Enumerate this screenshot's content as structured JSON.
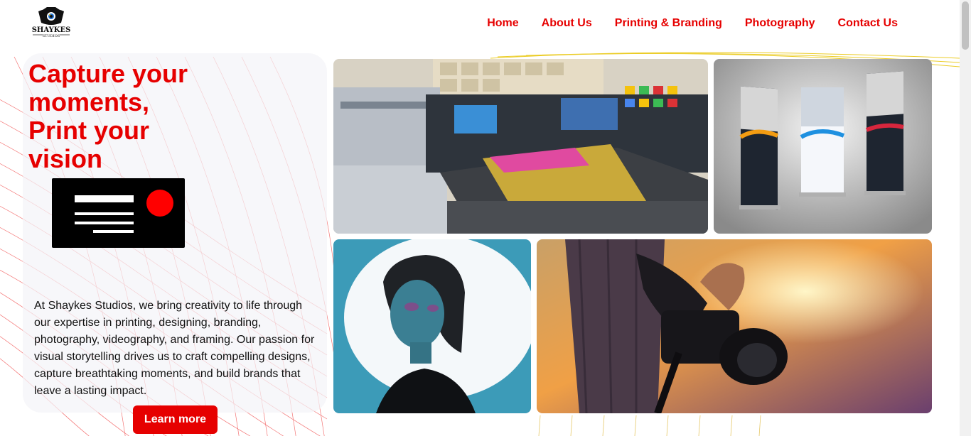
{
  "brand": {
    "name": "SHAYKES",
    "tagline": "STUDIOS"
  },
  "nav": {
    "items": [
      "Home",
      "About Us",
      "Printing & Branding",
      "Photography",
      "Contact Us"
    ]
  },
  "whatsapp": {
    "icon": "whatsapp-icon"
  },
  "hero": {
    "title_lines": [
      "Capture your",
      "moments,",
      "Print your",
      "vision"
    ],
    "description": "At Shaykes Studios, we bring creativity to life through our expertise in printing, designing, branding, photography, videography, and framing. Our passion for visual storytelling drives us to craft compelling designs, capture breathtaking moments, and build brands that leave a lasting impact.",
    "cta": "Learn more"
  },
  "colors": {
    "accent": "#e60000",
    "whatsapp": "#25d366",
    "text": "#111111"
  }
}
